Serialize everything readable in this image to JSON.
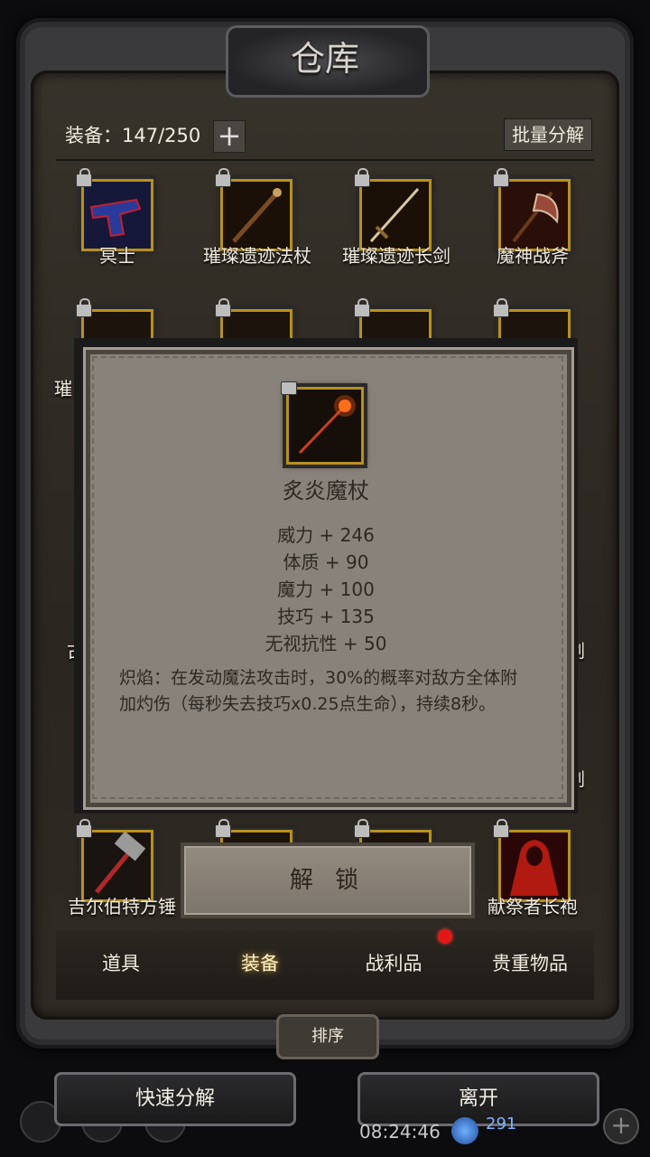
{
  "title": "仓库",
  "header": {
    "equip_label": "装备：147/250",
    "plus_symbol": "+",
    "bulk_decompose": "批量分解"
  },
  "items_row1": [
    {
      "name": "冥士",
      "icon": "pistol-icon"
    },
    {
      "name": "璀璨遗迹法杖",
      "icon": "staff-icon"
    },
    {
      "name": "璀璨遗迹长剑",
      "icon": "sword-icon"
    },
    {
      "name": "魔神战斧",
      "icon": "axe-icon"
    }
  ],
  "items_peek": {
    "left_row2": "璀",
    "left_row5": "古",
    "right_row5": "剑",
    "right_row6": "剑"
  },
  "items_last_row": [
    {
      "name": "吉尔伯特方锤",
      "icon": "hammer-icon"
    },
    {
      "name": "献祭者长袍",
      "icon": "robe-icon"
    }
  ],
  "modal": {
    "item_icon": "fire-staff-icon",
    "item_name": "炙炎魔杖",
    "stats": [
      "威力 + 246",
      "体质 + 90",
      "魔力 + 100",
      "技巧 + 135",
      "无视抗性 + 50"
    ],
    "description": "炽焰：在发动魔法攻击时，30%的概率对敌方全体附加灼伤（每秒失去技巧x0.25点生命），持续8秒。"
  },
  "unlock_button": "解 锁",
  "tabs": [
    {
      "label": "道具",
      "active": false
    },
    {
      "label": "装备",
      "active": true
    },
    {
      "label": "战利品",
      "active": false,
      "badge": true
    },
    {
      "label": "贵重物品",
      "active": false
    }
  ],
  "sort_button": "排序",
  "bottom_buttons": {
    "quick_decompose": "快速分解",
    "leave": "离开"
  },
  "status_bar": {
    "clock": "08:24:46",
    "gems": "291"
  },
  "colors": {
    "slot_border": "#b8901c",
    "modal_bg": "#89827a",
    "badge_red": "#e01818"
  }
}
